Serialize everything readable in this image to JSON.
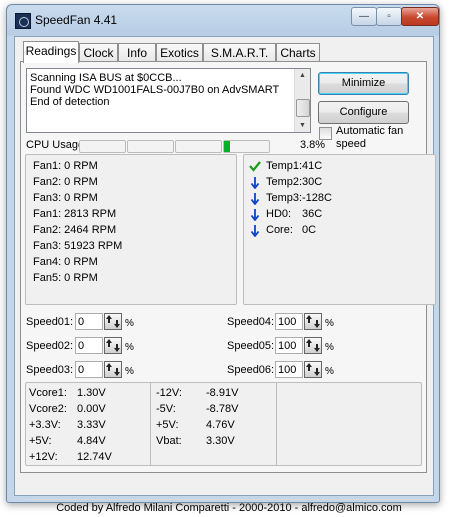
{
  "window": {
    "title": "SpeedFan 4.41",
    "min_glyph": "—",
    "max_glyph": "▫",
    "close_glyph": "✕"
  },
  "tabs": [
    {
      "label": "Readings",
      "active": true
    },
    {
      "label": "Clock"
    },
    {
      "label": "Info"
    },
    {
      "label": "Exotics"
    },
    {
      "label": "S.M.A.R.T."
    },
    {
      "label": "Charts"
    }
  ],
  "log": {
    "lines": [
      "Scanning ISA BUS at $0CCB...",
      "Found WDC WD1001FALS-00J7B0 on AdvSMART",
      "End of detection"
    ]
  },
  "buttons": {
    "minimize": "Minimize",
    "configure": "Configure"
  },
  "auto_fan": {
    "label": "Automatic fan speed",
    "checked": false
  },
  "cpu": {
    "label": "CPU Usage",
    "percent_text": "3.8%",
    "usage": 3.8,
    "fill_color": "#06b025"
  },
  "fans": [
    "Fan1: 0 RPM",
    "Fan2: 0 RPM",
    "Fan3: 0 RPM",
    "Fan1: 2813 RPM",
    "Fan2: 2464 RPM",
    "Fan3: 51923 RPM",
    "Fan4: 0 RPM",
    "Fan5: 0 RPM"
  ],
  "temps": [
    {
      "label": "Temp1:",
      "value": "41C",
      "icon": "check-icon",
      "color": "#1a9c1a"
    },
    {
      "label": "Temp2:",
      "value": "30C",
      "icon": "down-arrow-icon",
      "color": "#0b45c9"
    },
    {
      "label": "Temp3:",
      "value": "-128C",
      "icon": "down-arrow-icon",
      "color": "#0b45c9"
    },
    {
      "label": "HD0:",
      "value": "36C",
      "icon": "down-arrow-icon",
      "color": "#0b45c9"
    },
    {
      "label": "Core:",
      "value": "0C",
      "icon": "down-arrow-icon",
      "color": "#0b45c9"
    }
  ],
  "speeds": [
    {
      "label": "Speed01:",
      "value": "0"
    },
    {
      "label": "Speed02:",
      "value": "0"
    },
    {
      "label": "Speed03:",
      "value": "0"
    },
    {
      "label": "Speed04:",
      "value": "100"
    },
    {
      "label": "Speed05:",
      "value": "100"
    },
    {
      "label": "Speed06:",
      "value": "100"
    }
  ],
  "percent_sign": "%",
  "voltages": {
    "col1": [
      {
        "label": "Vcore1:",
        "value": "1.30V"
      },
      {
        "label": "Vcore2:",
        "value": "0.00V"
      },
      {
        "label": "+3.3V:",
        "value": "3.33V"
      },
      {
        "label": "+5V:",
        "value": "4.84V"
      },
      {
        "label": "+12V:",
        "value": "12.74V"
      }
    ],
    "col2": [
      {
        "label": "-12V:",
        "value": "-8.91V"
      },
      {
        "label": "-5V:",
        "value": "-8.78V"
      },
      {
        "label": "+5V:",
        "value": "4.76V"
      },
      {
        "label": "Vbat:",
        "value": "3.30V"
      }
    ]
  },
  "status": "Coded by Alfredo Milani Comparetti - 2000-2010 - alfredo@almico.com"
}
